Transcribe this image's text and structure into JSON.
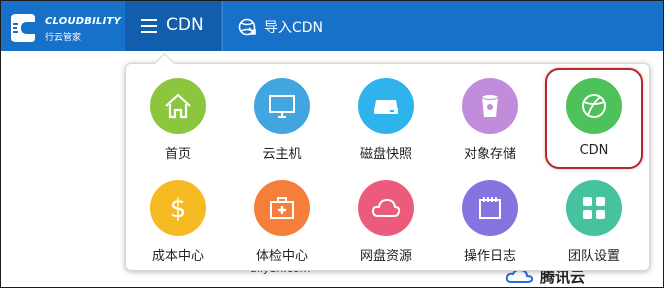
{
  "header": {
    "logo_brand": "CLOUDBILITY",
    "logo_sub": "行云管家",
    "menu_label": "CDN",
    "import_label": "导入CDN"
  },
  "background": {
    "logo_left_text": "aliyun.com",
    "logo_right_text": "腾讯云"
  },
  "menu": {
    "items": [
      {
        "label": "首页",
        "color": "#8cc63f",
        "icon": "home-icon"
      },
      {
        "label": "云主机",
        "color": "#43a5e0",
        "icon": "monitor-icon"
      },
      {
        "label": "磁盘快照",
        "color": "#2fb3ec",
        "icon": "disk-icon"
      },
      {
        "label": "对象存储",
        "color": "#c18ddb",
        "icon": "bucket-icon"
      },
      {
        "label": "CDN",
        "color": "#4ec15a",
        "icon": "globe-icon",
        "selected": true
      },
      {
        "label": "成本中心",
        "color": "#f6bb23",
        "icon": "dollar-icon"
      },
      {
        "label": "体检中心",
        "color": "#f57e3a",
        "icon": "medkit-icon"
      },
      {
        "label": "网盘资源",
        "color": "#ec5a7c",
        "icon": "cloud-icon"
      },
      {
        "label": "操作日志",
        "color": "#8474e0",
        "icon": "notebook-icon"
      },
      {
        "label": "团队设置",
        "color": "#47c29e",
        "icon": "grid-icon"
      }
    ]
  },
  "colors": {
    "topbar": "#1771c9",
    "menu_toggle_bg": "#125ead",
    "highlight_border": "#b12a2a"
  }
}
